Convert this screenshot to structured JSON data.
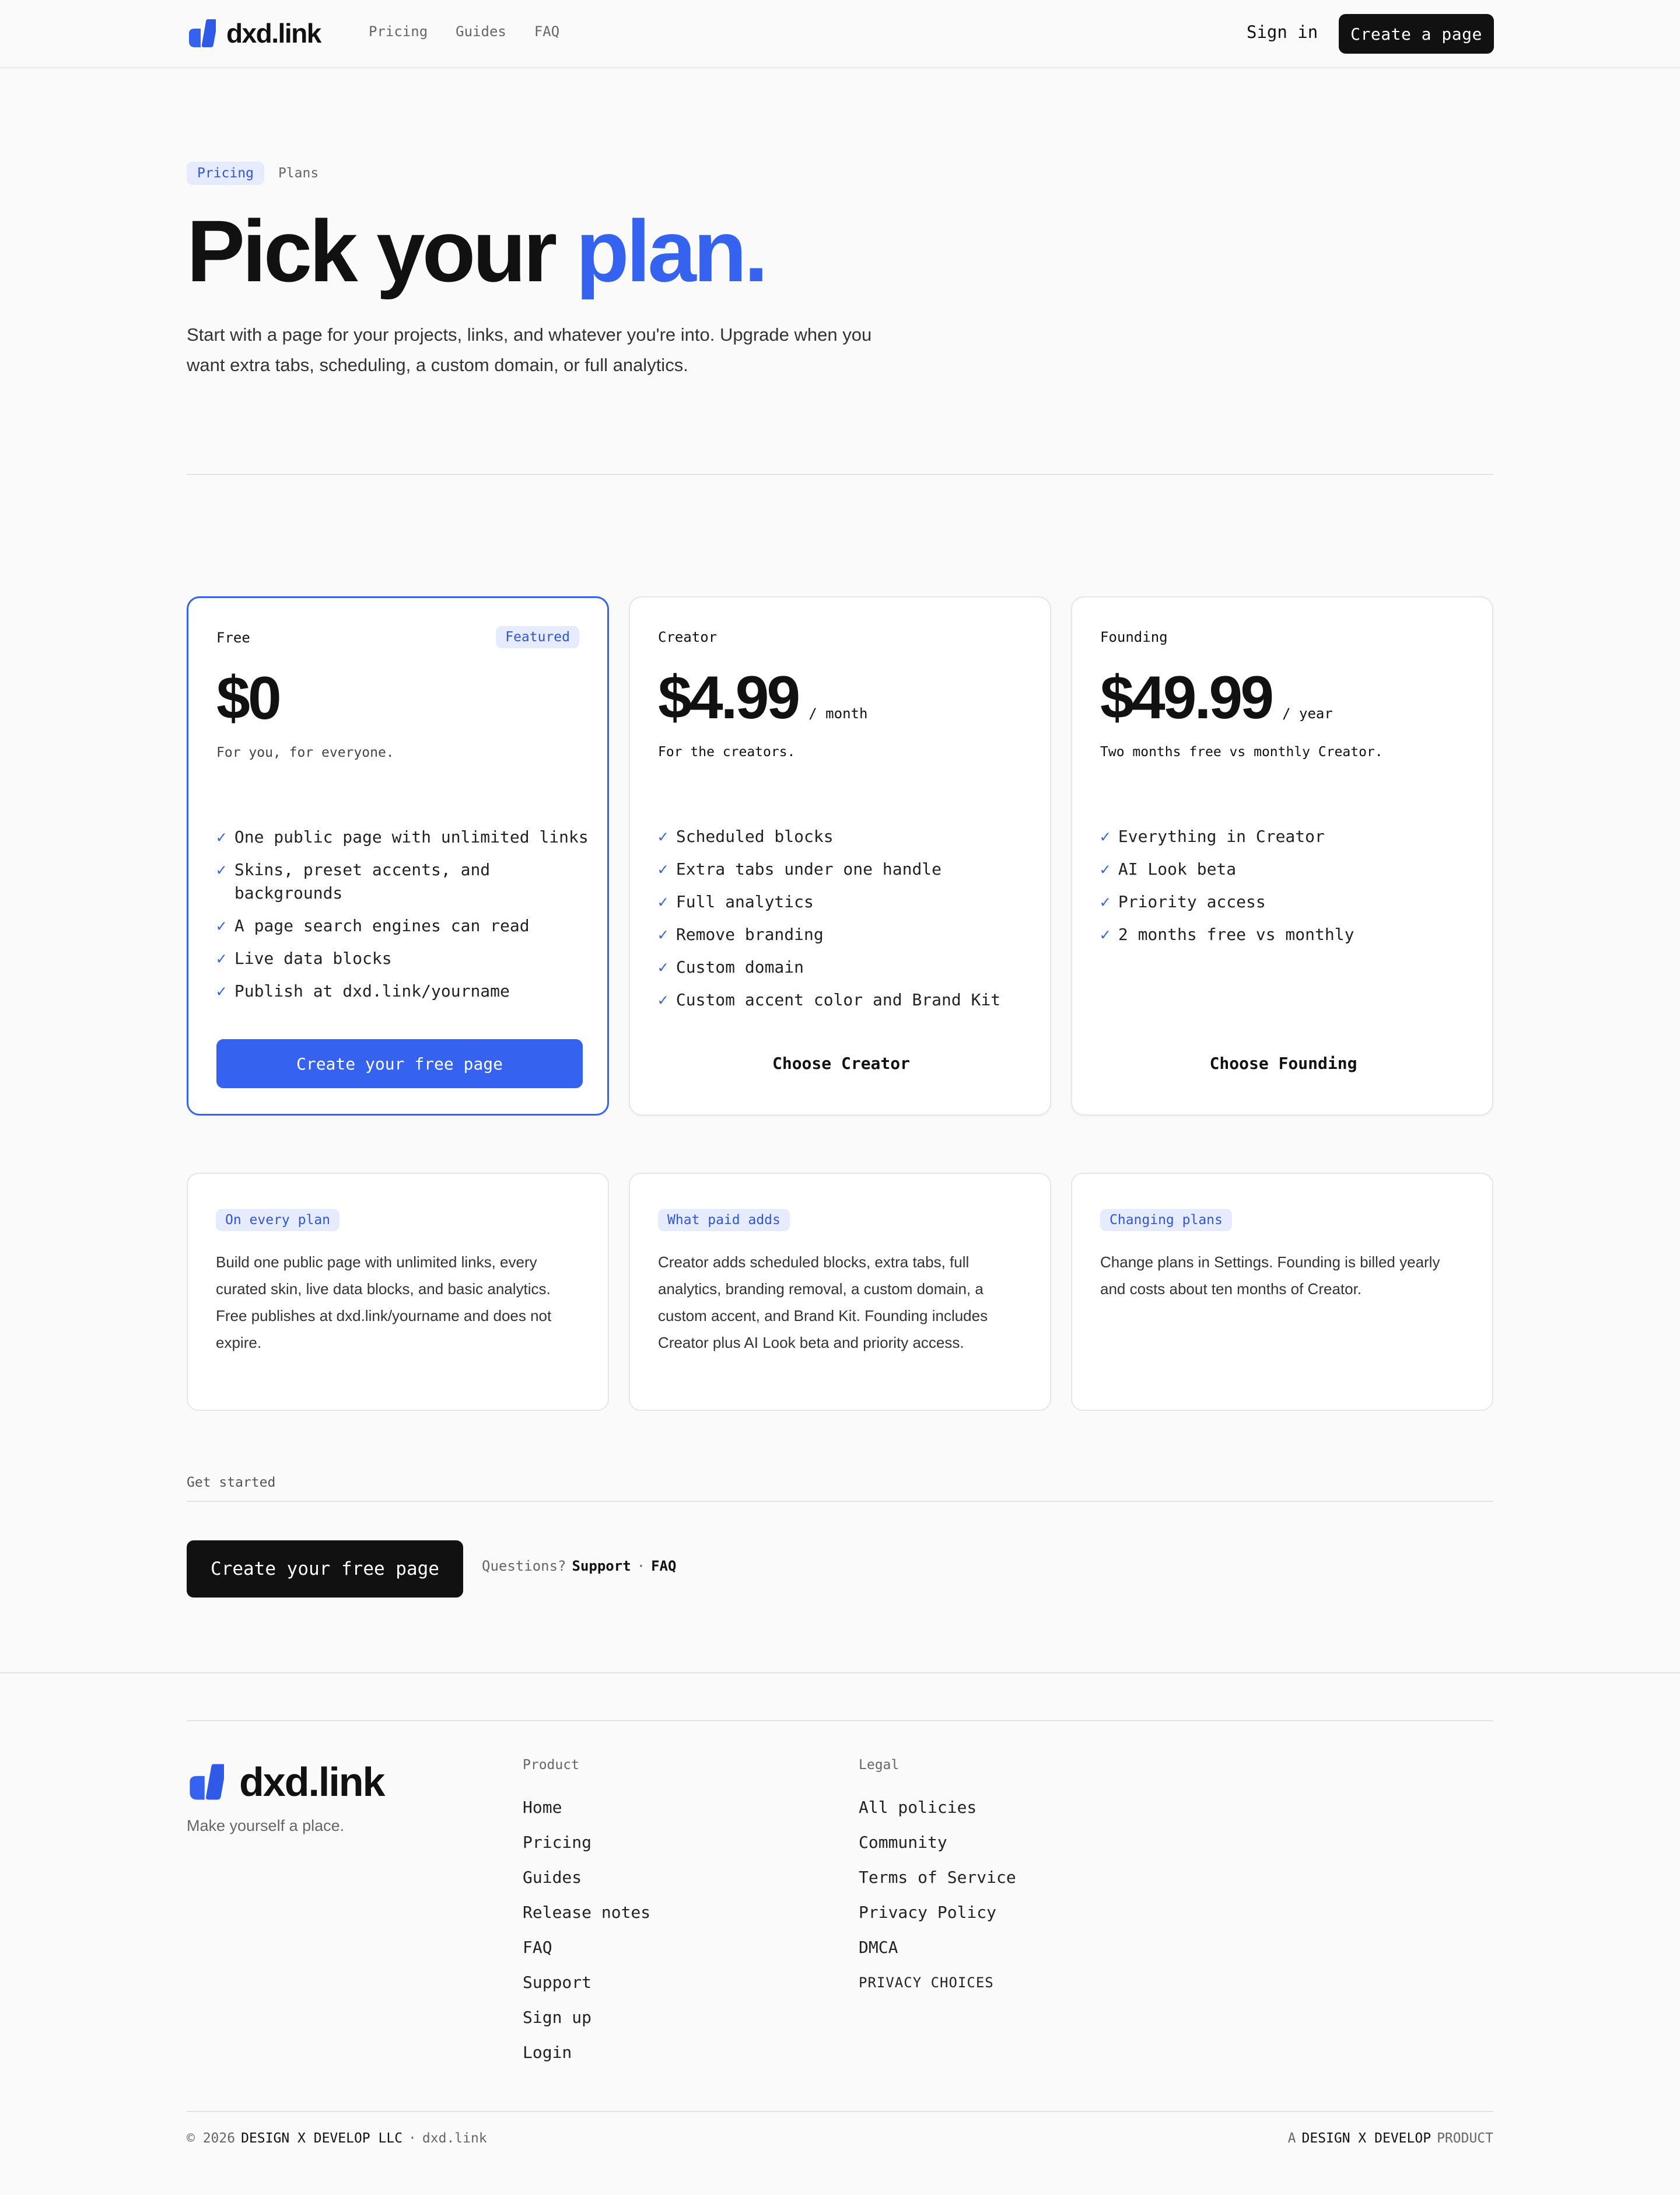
{
  "brand": {
    "name": "dxd.link",
    "tagline": "Make yourself a place.",
    "accent": "#3562ef"
  },
  "nav": {
    "items": [
      "Pricing",
      "Guides",
      "FAQ"
    ],
    "sign_in": "Sign in",
    "cta": "Create a page"
  },
  "breadcrumb": {
    "active": "Pricing",
    "current": "Plans"
  },
  "hero": {
    "title_main": "Pick your",
    "title_accent": "plan.",
    "subtitle": "Start with a page for your projects, links, and whatever you're into. Upgrade when you want extra tabs, scheduling, a custom domain, or full analytics."
  },
  "plans": [
    {
      "name": "Free",
      "badge": "Featured",
      "price": "$0",
      "period": "",
      "tagline": "For you, for everyone.",
      "features": [
        "One public page with unlimited links",
        "Skins, preset accents, and backgrounds",
        "A page search engines can read",
        "Live data blocks",
        "Publish at dxd.link/yourname"
      ],
      "button": "Create your free page"
    },
    {
      "name": "Creator",
      "badge": "",
      "price": "$4.99",
      "period": "/ month",
      "tagline": "For the creators.",
      "features": [
        "Scheduled blocks",
        "Extra tabs under one handle",
        "Full analytics",
        "Remove branding",
        "Custom domain",
        "Custom accent color and Brand Kit"
      ],
      "button": "Choose Creator"
    },
    {
      "name": "Founding",
      "badge": "",
      "price": "$49.99",
      "period": "/ year",
      "tagline": "Two months free vs monthly Creator.",
      "features": [
        "Everything in Creator",
        "AI Look beta",
        "Priority access",
        "2 months free vs monthly"
      ],
      "button": "Choose Founding"
    }
  ],
  "info_cards": [
    {
      "label": "On every plan",
      "text": "Build one public page with unlimited links, every curated skin, live data blocks, and basic analytics. Free publishes at dxd.link/yourname and does not expire."
    },
    {
      "label": "What paid adds",
      "text": "Creator adds scheduled blocks, extra tabs, full analytics, branding removal, a custom domain, a custom accent, and Brand Kit. Founding includes Creator plus AI Look beta and priority access."
    },
    {
      "label": "Changing plans",
      "text": "Change plans in Settings. Founding is billed yearly and costs about ten months of Creator."
    }
  ],
  "get_started": {
    "label": "Get started",
    "button": "Create your free page",
    "questions": "Questions?",
    "support": "Support",
    "separator": "·",
    "faq": "FAQ"
  },
  "footer": {
    "product_title": "Product",
    "product_links": [
      "Home",
      "Pricing",
      "Guides",
      "Release notes",
      "FAQ",
      "Support",
      "Sign up",
      "Login"
    ],
    "legal_title": "Legal",
    "legal_links": [
      "All policies",
      "Community",
      "Terms of Service",
      "Privacy Policy",
      "DMCA",
      "PRIVACY CHOICES"
    ],
    "copyright": "© 2026",
    "company": "DESIGN X DEVELOP LLC",
    "separator": "·",
    "domain": "dxd.link",
    "right_prefix": "A",
    "right_company": "DESIGN X DEVELOP",
    "right_suffix": "PRODUCT"
  }
}
